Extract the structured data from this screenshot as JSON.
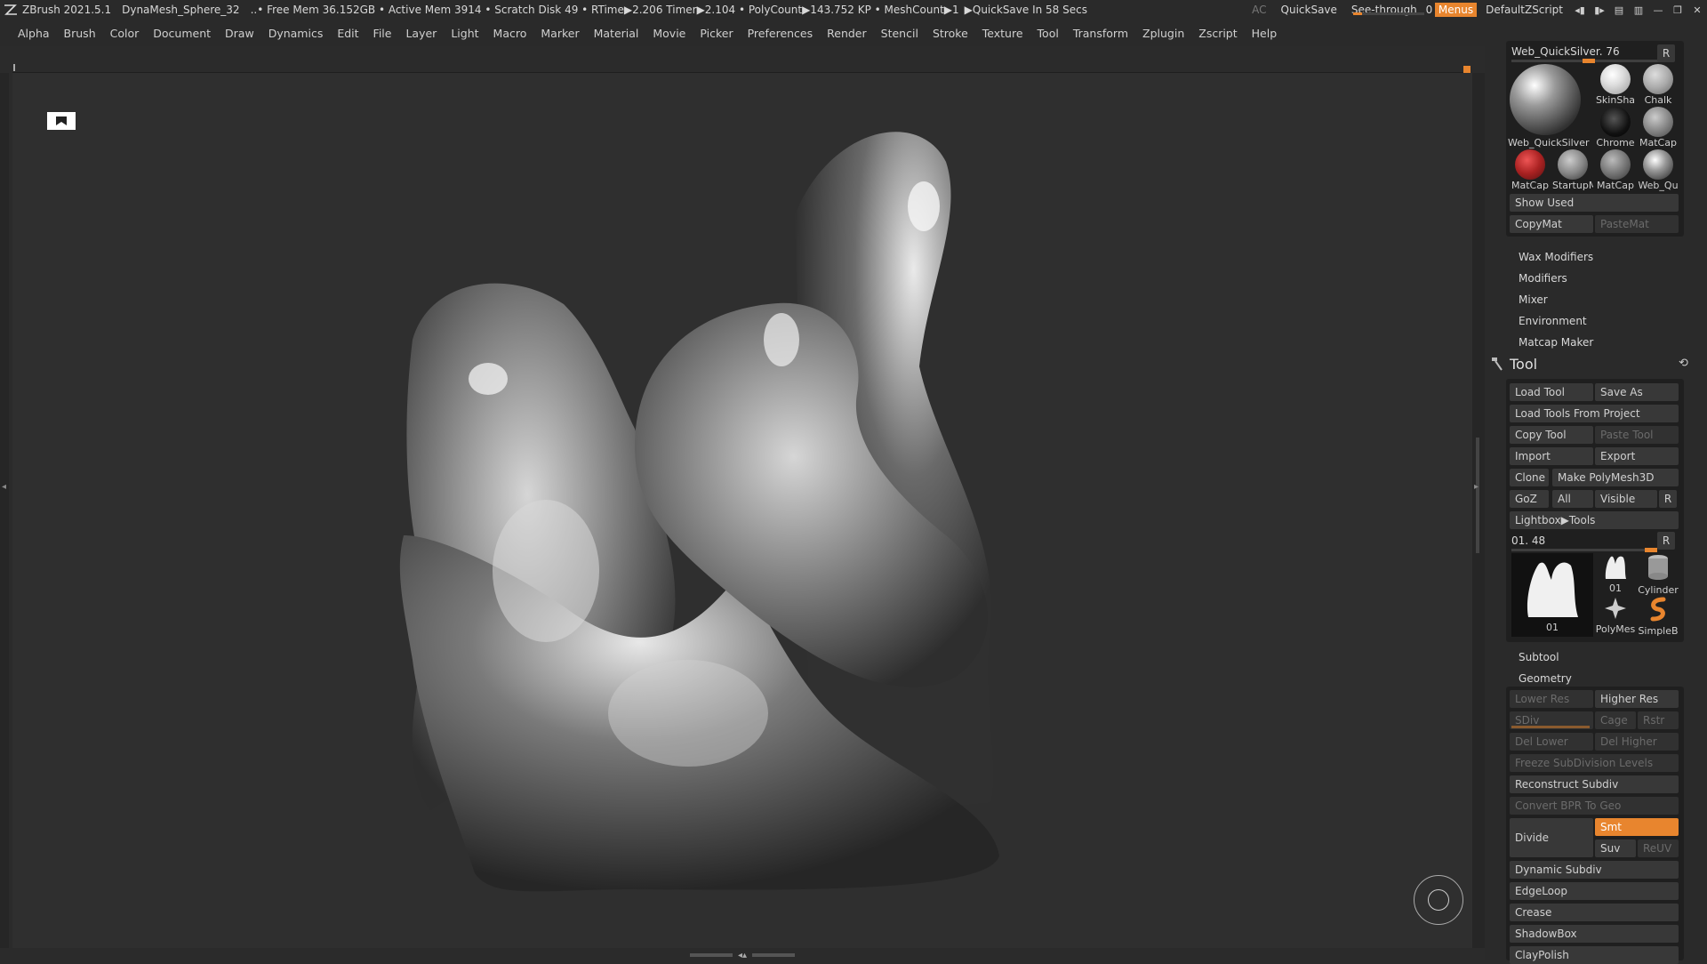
{
  "titlebar": {
    "app": "ZBrush 2021.5.1",
    "doc": "DynaMesh_Sphere_32",
    "stats": "..• Free Mem 36.152GB • Active Mem 3914 • Scratch Disk 49 • RTime▶2.206 Timer▶2.104 • PolyCount▶143.752 KP • MeshCount▶1",
    "quicksave_timer": "▶QuickSave In 58 Secs",
    "ac": "AC",
    "quicksave": "QuickSave",
    "seethrough": "See-through",
    "seethrough_value": "0",
    "menus": "Menus",
    "script": "DefaultZScript"
  },
  "menubar": [
    "Alpha",
    "Brush",
    "Color",
    "Document",
    "Draw",
    "Dynamics",
    "Edit",
    "File",
    "Layer",
    "Light",
    "Macro",
    "Marker",
    "Material",
    "Movie",
    "Picker",
    "Preferences",
    "Render",
    "Stencil",
    "Stroke",
    "Texture",
    "Tool",
    "Transform",
    "Zplugin",
    "Zscript",
    "Help"
  ],
  "material": {
    "slider_label": "Web_QuickSilver. 76",
    "slider_value": 0.76,
    "r": "R",
    "main": "Web_QuickSilver",
    "thumbs": [
      "SkinSha",
      "Chalk",
      "Chrome",
      "MatCap",
      "MatCap",
      "StartupM",
      "MatCap",
      "Web_Qu"
    ],
    "show_used": "Show Used",
    "copy": "CopyMat",
    "paste": "PasteMat"
  },
  "sections": [
    "Wax Modifiers",
    "Modifiers",
    "Mixer",
    "Environment",
    "Matcap Maker"
  ],
  "tool": {
    "title": "Tool",
    "load": "Load Tool",
    "save_as": "Save As",
    "load_project": "Load Tools From Project",
    "copy": "Copy Tool",
    "paste": "Paste Tool",
    "import": "Import",
    "export": "Export",
    "clone": "Clone",
    "polymesh": "Make PolyMesh3D",
    "goz": "GoZ",
    "all": "All",
    "visible": "Visible",
    "r": "R",
    "lightbox": "Lightbox▶Tools",
    "slider_label": "01. 48",
    "slider_value": 0.48,
    "main_thumb": "01",
    "thumbs": [
      "01",
      "Cylinder",
      "PolyMes",
      "SimpleB"
    ]
  },
  "subtool": "Subtool",
  "geometry": {
    "title": "Geometry",
    "lower": "Lower Res",
    "higher": "Higher Res",
    "sdiv": "SDiv",
    "cage": "Cage",
    "rstr": "Rstr",
    "del_lower": "Del Lower",
    "del_higher": "Del Higher",
    "freeze": "Freeze SubDivision Levels",
    "reconstruct": "Reconstruct Subdiv",
    "convert": "Convert BPR To Geo",
    "divide": "Divide",
    "smt": "Smt",
    "suv": "Suv",
    "reuv": "ReUV",
    "items": [
      "Dynamic Subdiv",
      "EdgeLoop",
      "Crease",
      "ShadowBox",
      "ClayPolish"
    ]
  },
  "colors": {
    "accent": "#e8852e",
    "bg": "#2a2a2a",
    "canvas": "#2f2f2f"
  }
}
